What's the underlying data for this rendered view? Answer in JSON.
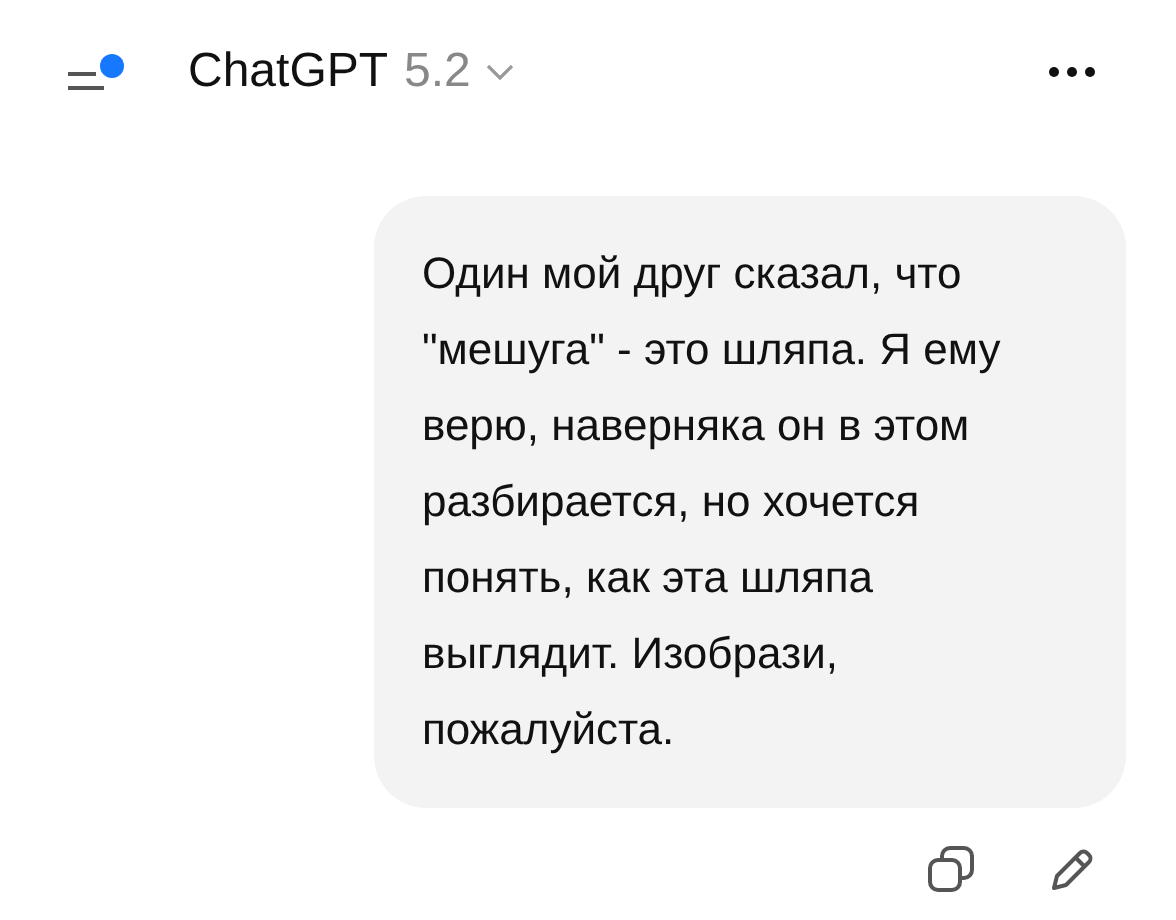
{
  "header": {
    "model_name": "ChatGPT",
    "model_version": "5.2"
  },
  "messages": [
    {
      "kind": "outgoing",
      "text": "Один мой друг сказал, что \"мешуга\" - это шляпа. Я ему верю, наверняка он в этом разбирается, но хочется понять, как эта шляпа выглядит. Изобрази, пожалуйста."
    }
  ]
}
